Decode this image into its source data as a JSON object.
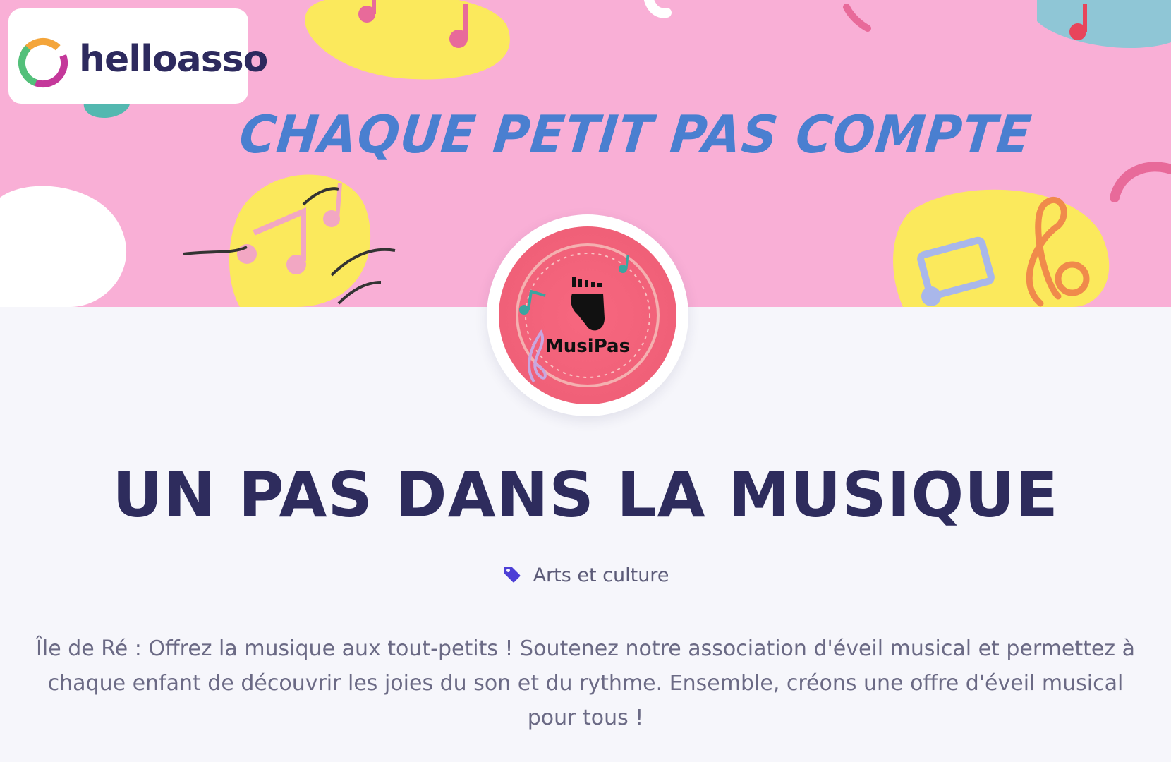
{
  "banner": {
    "tagline": "CHAQUE PETIT PAS COMPTE"
  },
  "brand": {
    "name": "helloasso",
    "icon": "helloasso-logo-icon"
  },
  "organization": {
    "avatar_label": "MusiPas",
    "title": "UN PAS DANS LA MUSIQUE",
    "category": "Arts et culture",
    "category_icon": "tag-icon",
    "description": "Île de Ré : Offrez la musique aux tout-petits ! Soutenez notre association d'éveil musical et permettez à chaque enfant de découvrir les joies du son et du rythme. Ensemble, créons une offre d'éveil musical pour tous !"
  },
  "colors": {
    "banner_bg": "#f9afd6",
    "tagline": "#4a7fd0",
    "title": "#2e2c5d",
    "tag_icon": "#4d3fd6",
    "page_bg": "#f6f6fb"
  }
}
